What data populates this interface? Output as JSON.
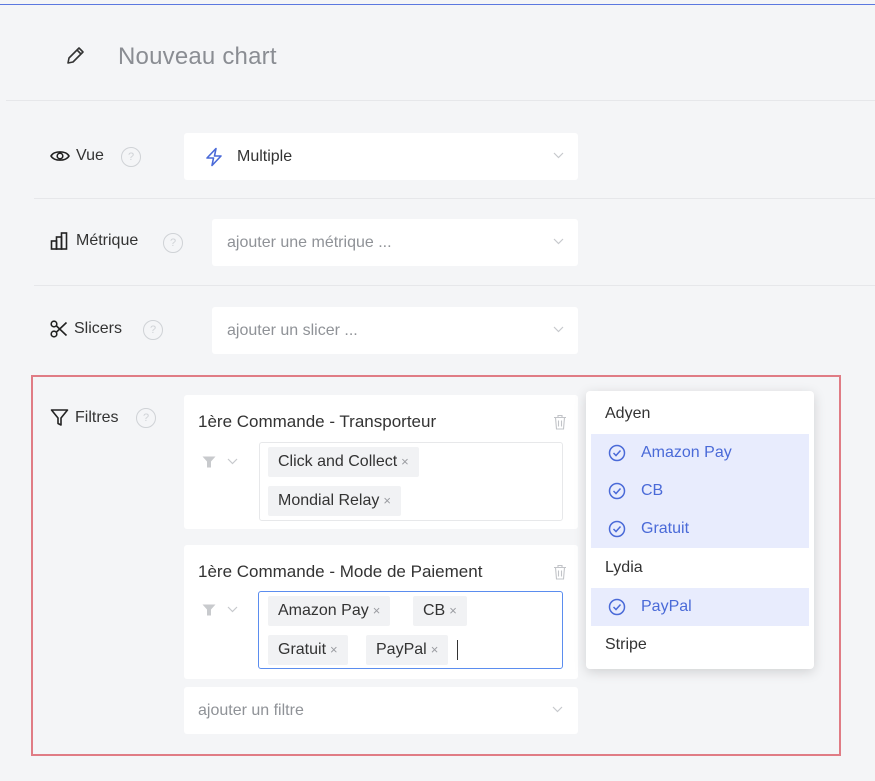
{
  "header": {
    "title": "Nouveau chart",
    "icon": "pencil-icon"
  },
  "vue": {
    "label": "Vue",
    "value": "Multiple",
    "value_icon": "lightning-icon",
    "help": "?"
  },
  "metrique": {
    "label": "Métrique",
    "placeholder": "ajouter une métrique ...",
    "help": "?"
  },
  "slicers": {
    "label": "Slicers",
    "placeholder": "ajouter un slicer ...",
    "help": "?"
  },
  "filtres": {
    "label": "Filtres",
    "help": "?",
    "filters": [
      {
        "title": "1ère Commande - Transporteur",
        "tags": [
          "Click and Collect",
          "Mondial Relay"
        ]
      },
      {
        "title": "1ère Commande - Mode de Paiement",
        "tags": [
          "Amazon Pay",
          "CB",
          "Gratuit",
          "PayPal"
        ]
      }
    ],
    "add_placeholder": "ajouter un filtre",
    "tag_remove": "×"
  },
  "dropdown": {
    "options": [
      {
        "label": "Adyen",
        "selected": false
      },
      {
        "label": "Amazon Pay",
        "selected": true
      },
      {
        "label": "CB",
        "selected": true
      },
      {
        "label": "Gratuit",
        "selected": true
      },
      {
        "label": "Lydia",
        "selected": false
      },
      {
        "label": "PayPal",
        "selected": true
      },
      {
        "label": "Stripe",
        "selected": false
      }
    ]
  },
  "colors": {
    "accent": "#4a6ad8",
    "selected_bg": "#e8ecfd",
    "highlight_border": "#e07c85"
  }
}
